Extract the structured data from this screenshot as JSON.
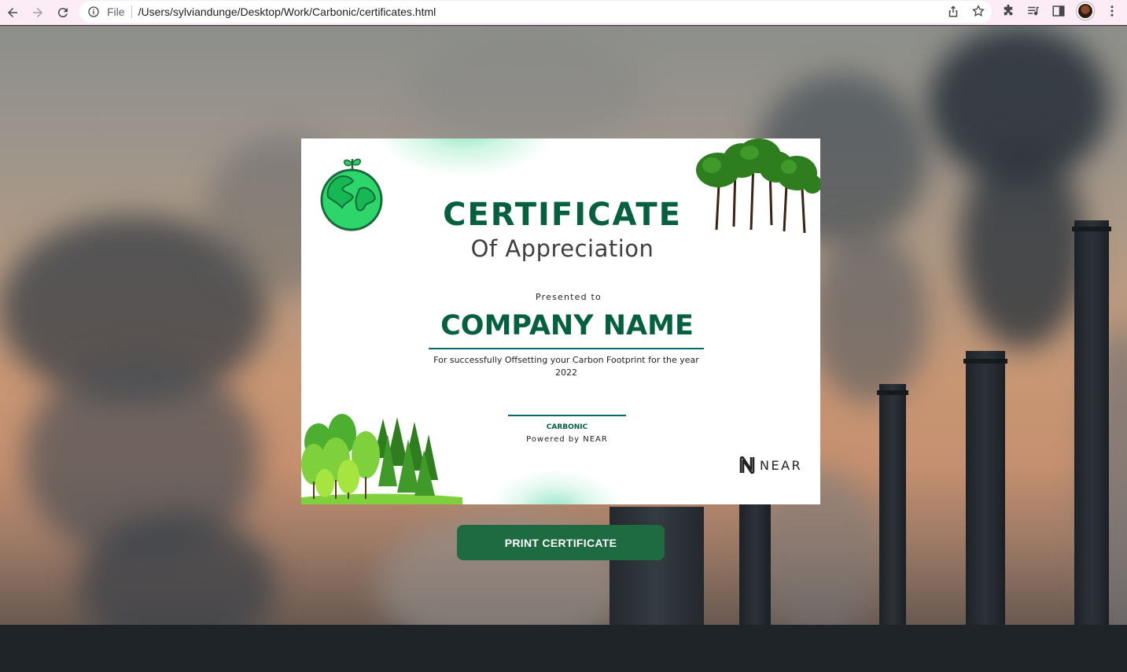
{
  "browser": {
    "scheme_label": "File",
    "url": "/Users/sylviandunge/Desktop/Work/Carbonic/certificates.html"
  },
  "certificate": {
    "title": "CERTIFICATE",
    "subtitle": "Of Appreciation",
    "presented_to": "Presented to",
    "recipient": "COMPANY NAME",
    "description": "For successfully Offsetting your Carbon Footprint for the year 2022",
    "signatory": "CARBONIC",
    "powered_by": "Powered by NEAR",
    "partner_logo": "NEAR"
  },
  "actions": {
    "print_label": "PRINT CERTIFICATE"
  },
  "colors": {
    "brand_green": "#05603f",
    "button_green": "#1e6b42",
    "accent_teal": "#0a6a6a"
  }
}
